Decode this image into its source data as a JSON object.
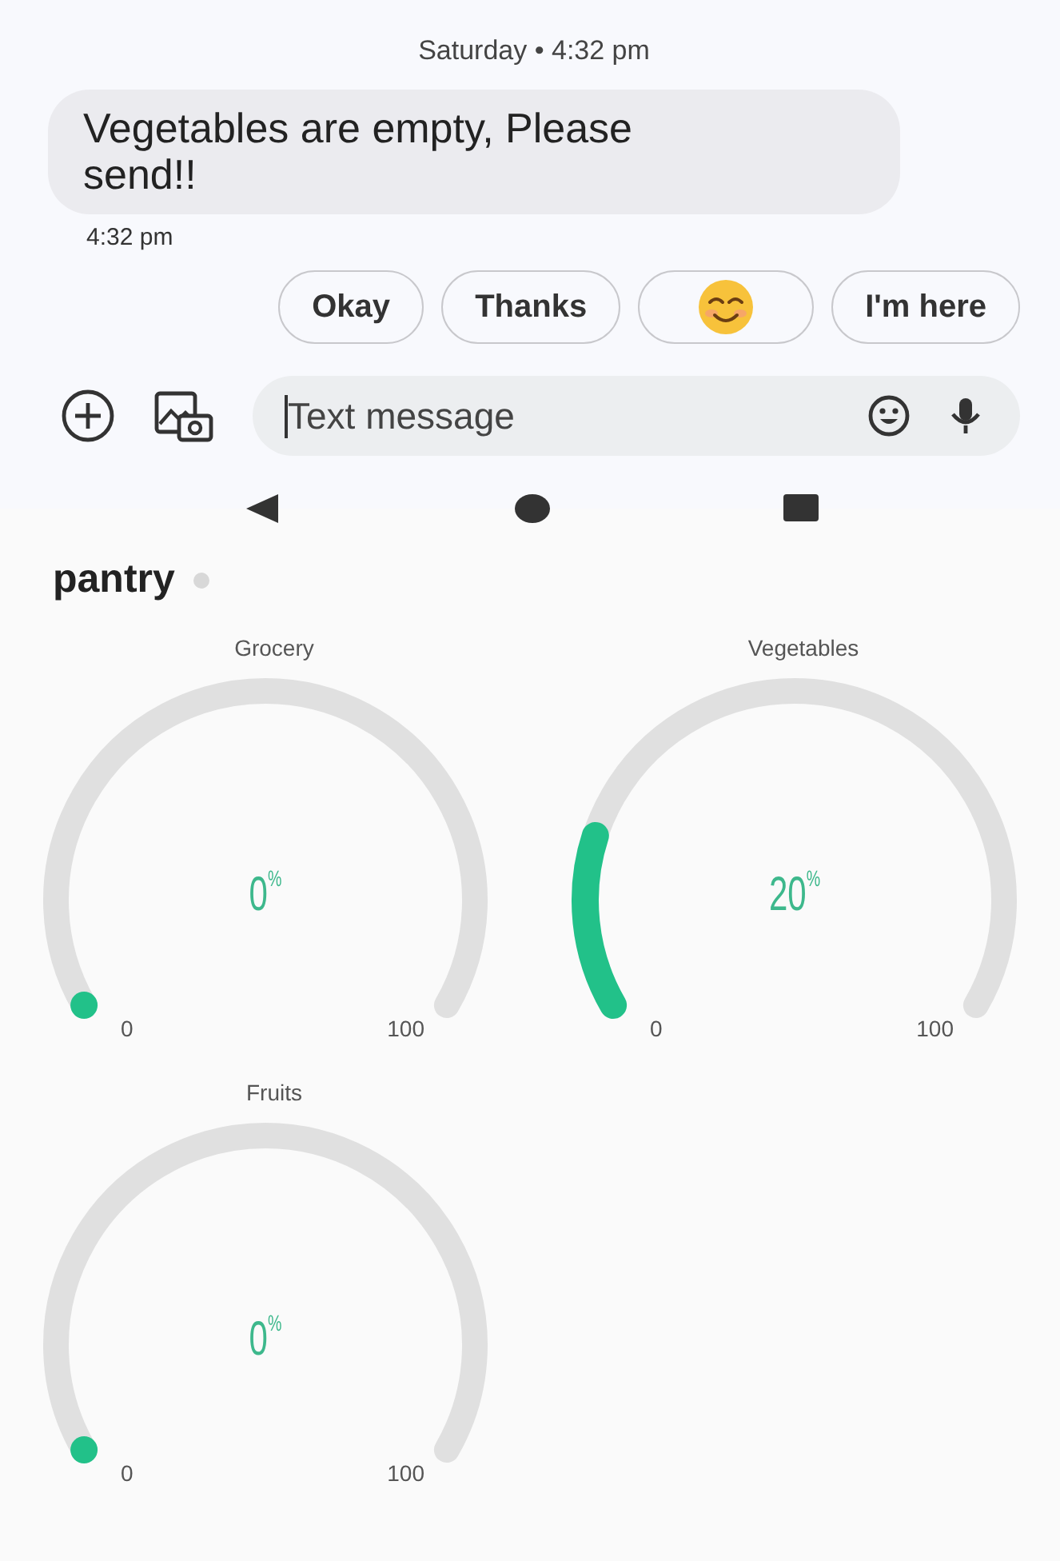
{
  "conversation": {
    "date_header": "Saturday • 4:32 pm",
    "messages": [
      {
        "text": "Vegetables are empty, Please send!!",
        "time": "4:32 pm"
      }
    ],
    "smart_replies": [
      {
        "kind": "text",
        "label": "Okay"
      },
      {
        "kind": "text",
        "label": "Thanks"
      },
      {
        "kind": "emoji"
      },
      {
        "kind": "text",
        "label": "I'm here"
      }
    ],
    "compose": {
      "placeholder": "Text message"
    }
  },
  "dashboard": {
    "title": "pantry",
    "gauges": [
      {
        "label": "Grocery",
        "value": "0",
        "unit": "%",
        "min": "0",
        "max": "100"
      },
      {
        "label": "Vegetables",
        "value": "20",
        "unit": "%",
        "min": "0",
        "max": "100"
      },
      {
        "label": "Fruits",
        "value": "0",
        "unit": "%",
        "min": "0",
        "max": "100"
      }
    ]
  }
}
